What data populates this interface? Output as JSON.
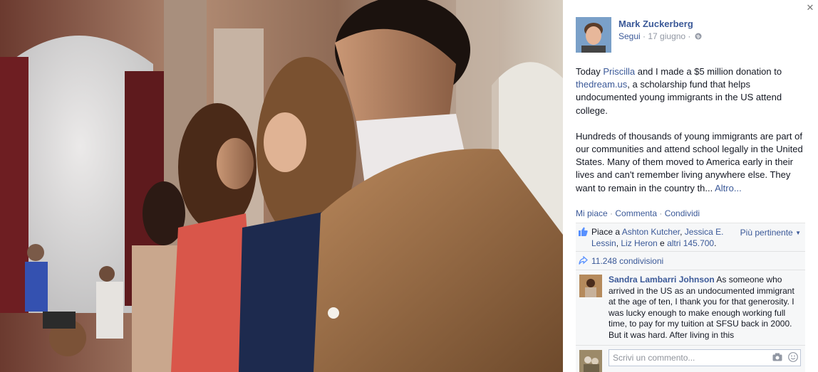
{
  "photo": {
    "icon": "photo-people-standing"
  },
  "post": {
    "author": "Mark Zuckerberg",
    "follow_label": "Segui",
    "separator": " · ",
    "date": "17 giugno",
    "audience_icon": "globe-icon",
    "text": {
      "p1_a": "Today ",
      "p1_link1": "Priscilla",
      "p1_b": " and I made a $5 million donation to ",
      "p1_link2": "thedream.us",
      "p1_c": ", a scholarship fund that helps undocumented young immigrants in the US attend college.",
      "p2": "Hundreds of thousands of young immigrants are part of our communities and attend school legally in the United States. Many of them moved to America early in their lives and can't remember living anywhere else. They want to remain in the country th... ",
      "more": "Altro..."
    },
    "actions": {
      "like": "Mi piace",
      "comment": "Commenta",
      "share": "Condividi",
      "sep": " · "
    }
  },
  "ufi": {
    "likes": {
      "prefix": "Piace a ",
      "name1": "Ashton Kutcher",
      "comma": ", ",
      "name2": "Jessica E. Lessin",
      "comma2": ", ",
      "name3": "Liz Heron",
      "and": " e ",
      "others": "altri 145.700",
      "end": ".",
      "sort_label": "Più pertinente",
      "sort_icon": "caret-down-icon"
    },
    "shares": {
      "count": "11.248 condivisioni"
    },
    "comment": {
      "author": "Sandra Lambarri Johnson",
      "text": " As someone who arrived in the US as an undocumented immigrant at the age of ten, I thank you for that generosity. I was lucky enough to make enough working full time, to pay for my tuition at SFSU back in 2000. But it was hard. After living in this"
    },
    "composer": {
      "placeholder": "Scrivi un commento...",
      "camera_icon": "camera-icon",
      "emoji_icon": "emoji-icon"
    }
  },
  "colors": {
    "link": "#3b5998",
    "meta": "#9197a3",
    "ufi_bg": "#f6f7f8"
  }
}
